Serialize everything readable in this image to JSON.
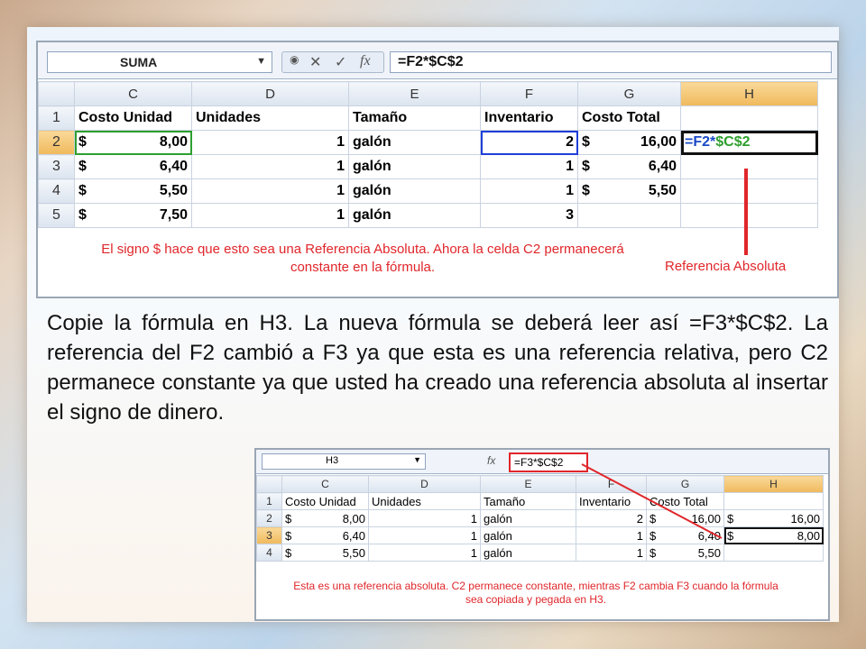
{
  "shot1": {
    "name_box": "SUMA",
    "formula": "=F2*$C$2",
    "headers": [
      "",
      "C",
      "D",
      "E",
      "F",
      "G",
      "H"
    ],
    "header_row": {
      "n": "1",
      "c": "Costo Unidad",
      "d": "Unidades",
      "e": "Tamaño",
      "f": "Inventario",
      "g": "Costo Total",
      "h": ""
    },
    "rows": [
      {
        "n": "2",
        "c_sym": "$",
        "c_val": "8,00",
        "d": "1",
        "e": "galón",
        "f": "2",
        "g_sym": "$",
        "g_val": "16,00",
        "h_a": "=F2*",
        "h_b": "$C$2"
      },
      {
        "n": "3",
        "c_sym": "$",
        "c_val": "6,40",
        "d": "1",
        "e": "galón",
        "f": "1",
        "g_sym": "$",
        "g_val": "6,40"
      },
      {
        "n": "4",
        "c_sym": "$",
        "c_val": "5,50",
        "d": "1",
        "e": "galón",
        "f": "1",
        "g_sym": "$",
        "g_val": "5,50"
      },
      {
        "n": "5",
        "c_sym": "$",
        "c_val": "7,50",
        "d": "1",
        "e": "galón",
        "f": "3"
      }
    ],
    "note": "El signo $ hace que esto sea una Referencia Absoluta. Ahora la celda C2 permanecerá constante en la fórmula.",
    "label": "Referencia Absoluta"
  },
  "paragraph": "Copie la fórmula en H3. La nueva fórmula se deberá leer así =F3*$C$2. La referencia del F2 cambió a F3 ya que esta es una referencia relativa, pero C2 permanece constante ya que usted ha creado una referencia absoluta al insertar el signo de dinero.",
  "shot2": {
    "name_box": "H3",
    "formula": "=F3*$C$2",
    "headers": [
      "",
      "C",
      "D",
      "E",
      "F",
      "G",
      "H"
    ],
    "header_row": {
      "n": "1",
      "c": "Costo Unidad",
      "d": "Unidades",
      "e": "Tamaño",
      "f": "Inventario",
      "g": "Costo Total",
      "h": ""
    },
    "rows": [
      {
        "n": "2",
        "c_sym": "$",
        "c_val": "8,00",
        "d": "1",
        "e": "galón",
        "f": "2",
        "g_sym": "$",
        "g_val": "16,00",
        "h_sym": "$",
        "h_val": "16,00"
      },
      {
        "n": "3",
        "c_sym": "$",
        "c_val": "6,40",
        "d": "1",
        "e": "galón",
        "f": "1",
        "g_sym": "$",
        "g_val": "6,40",
        "h_sym": "$",
        "h_val": "8,00"
      },
      {
        "n": "4",
        "c_sym": "$",
        "c_val": "5,50",
        "d": "1",
        "e": "galón",
        "f": "1",
        "g_sym": "$",
        "g_val": "5,50"
      }
    ],
    "note": "Esta es una referencia absoluta. C2 permanece constante, mientras F2 cambia F3 cuando la fórmula sea copiada y pegada en H3."
  },
  "colors": {
    "accent_red": "#e0262a",
    "ref_blue": "#1a49c6",
    "ref_green": "#2e9f2e"
  },
  "icons": {
    "cancel": "✕",
    "enter": "✓",
    "fx": "fx",
    "dropdown": "▼"
  }
}
